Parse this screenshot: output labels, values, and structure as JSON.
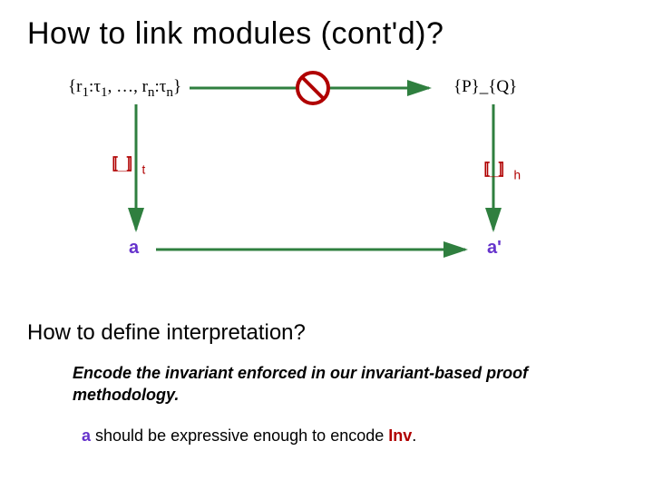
{
  "title": "How to link modules (cont'd)?",
  "diagram": {
    "leftTop_pre": "{r",
    "leftTop_sub1": "1",
    "leftTop_mid1": ":τ",
    "leftTop_sub2": "1",
    "leftTop_mid2": ", …, r",
    "leftTop_sub3": "n",
    "leftTop_mid3": ":τ",
    "leftTop_sub4": "n",
    "leftTop_post": "}",
    "rightTop": "{P}_{Q}",
    "leftBracket_open": "〚_〛",
    "leftBracket_sub": "t",
    "rightBracket_open": "〚_〛",
    "rightBracket_sub": "h",
    "a": "a",
    "aPrime": "a'"
  },
  "question": "How to define interpretation?",
  "bodyLine1": "Encode the invariant enforced in our invariant-based proof methodology.",
  "bodyLine2_pre": "",
  "bodyLine2_a": "a",
  "bodyLine2_mid": " should be expressive enough to encode ",
  "bodyLine2_inv": "Inv",
  "bodyLine2_post": "."
}
